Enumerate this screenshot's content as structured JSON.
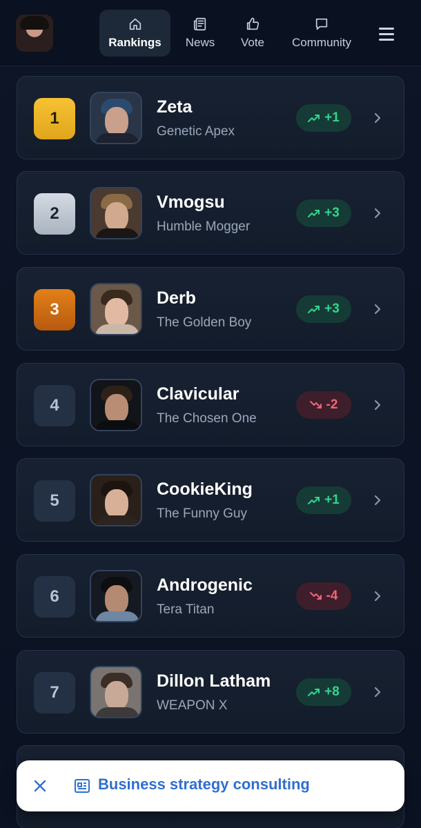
{
  "nav": {
    "items": [
      {
        "label": "Rankings",
        "icon": "home-icon",
        "active": true
      },
      {
        "label": "News",
        "icon": "newspaper-icon",
        "active": false
      },
      {
        "label": "Vote",
        "icon": "thumbs-up-icon",
        "active": false
      },
      {
        "label": "Community",
        "icon": "chat-bubble-icon",
        "active": false
      }
    ],
    "menu_icon": "hamburger-menu-icon"
  },
  "colors": {
    "background": "#0b1222",
    "card": "#172131",
    "trend_up": "#33d48f",
    "trend_down": "#f2647a",
    "gold": "#f7c234",
    "silver": "#c4cbd6",
    "bronze": "#d9741a",
    "link_blue": "#2f6fcf"
  },
  "rankings": [
    {
      "rank": "1",
      "name": "Zeta",
      "title": "Genetic Apex",
      "change": "+1",
      "trend": "up",
      "tier": "gold"
    },
    {
      "rank": "2",
      "name": "Vmogsu",
      "title": "Humble Mogger",
      "change": "+3",
      "trend": "up",
      "tier": "silver"
    },
    {
      "rank": "3",
      "name": "Derb",
      "title": "The Golden Boy",
      "change": "+3",
      "trend": "up",
      "tier": "bronze"
    },
    {
      "rank": "4",
      "name": "Clavicular",
      "title": "The Chosen One",
      "change": "-2",
      "trend": "down",
      "tier": "plain"
    },
    {
      "rank": "5",
      "name": "CookieKing",
      "title": "The Funny Guy",
      "change": "+1",
      "trend": "up",
      "tier": "plain"
    },
    {
      "rank": "6",
      "name": "Androgenic",
      "title": "Tera Titan",
      "change": "-4",
      "trend": "down",
      "tier": "plain"
    },
    {
      "rank": "7",
      "name": "Dillon Latham",
      "title": "WEAPON X",
      "change": "+8",
      "trend": "up",
      "tier": "plain"
    }
  ],
  "toast": {
    "label": "Business strategy consulting",
    "icon": "newspaper-icon",
    "close_icon": "close-icon"
  }
}
